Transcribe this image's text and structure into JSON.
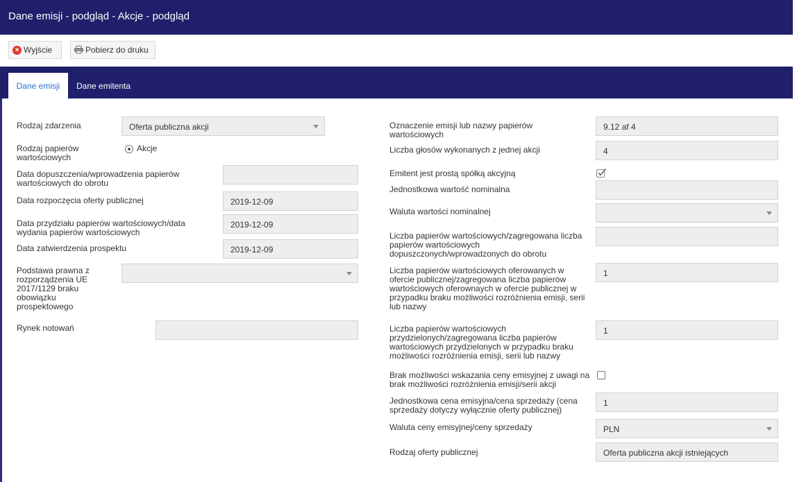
{
  "window": {
    "title": "Dane emisji - podgląd - Akcje - podgląd"
  },
  "toolbar": {
    "exit_label": "Wyjście",
    "print_label": "Pobierz do druku"
  },
  "tabs": [
    {
      "label": "Dane emisji"
    },
    {
      "label": "Dane emitenta"
    }
  ],
  "left": {
    "rodzaj_zdarzenia": {
      "label": "Rodzaj zdarzenia",
      "value": "Oferta publiczna akcji"
    },
    "rodzaj_papierow": {
      "label": "Rodzaj papierów wartościowych",
      "value": "Akcje"
    },
    "data_dopuszczenia": {
      "label": "Data dopuszczenia/wprowadzenia papierów wartościowych do obrotu",
      "value": ""
    },
    "data_rozpoczecia": {
      "label": "Data rozpoczęcia oferty publicznej",
      "value": "2019-12-09"
    },
    "data_przydzialu": {
      "label": "Data przydziału papierów wartościowych/data wydania papierów wartościowych",
      "value": "2019-12-09"
    },
    "data_zatwierdzenia": {
      "label": "Data zatwierdzenia prospektu",
      "value": "2019-12-09"
    },
    "podstawa_prawna": {
      "label": "Podstawa prawna z rozporządzenia UE 2017/1129 braku obowiązku prospektowego",
      "value": ""
    },
    "rynek_notowan": {
      "label": "Rynek notowań",
      "value": ""
    }
  },
  "right": {
    "oznaczenie": {
      "label": "Oznaczenie emisji lub nazwy papierów wartościowych",
      "value": "9.12 af 4"
    },
    "liczba_glosow": {
      "label": "Liczba głosów wykonanych z jednej akcji",
      "value": "4"
    },
    "prosta_spolka": {
      "label": "Emitent jest prostą spółką akcyjną"
    },
    "wartosc_nominalna": {
      "label": "Jednostkowa wartość nominalna",
      "value": ""
    },
    "waluta_nominalnej": {
      "label": "Waluta wartości nominalnej",
      "value": ""
    },
    "liczba_dopuszczonych": {
      "label": "Liczba papierów wartościowych/zagregowana liczba papierów wartościowych dopuszczonych/wprowadzonych do obrotu",
      "value": ""
    },
    "liczba_oferowanych": {
      "label": "Liczba papierów wartościowych oferowanych w ofercie publicznej/zagregowana liczba papierów wartościowych oferownaych w ofercie publicznej w przypadku braku możliwości rozróżnienia emisji, serii lub nazwy",
      "value": "1"
    },
    "liczba_przydzielonych": {
      "label": "Liczba papierów wartościowych przydzielonych/zagregowana liczba papierów wartościowych przydzielonych w przypadku braku możliwości rozróżnienia emisji, serii lub nazwy",
      "value": "1"
    },
    "brak_ceny": {
      "label": "Brak możliwości wskazania ceny emisyjnej z uwagi na brak możliwości rozróżnienia emisji/serii akcji"
    },
    "cena_emisyjna": {
      "label": "Jednostkowa cena emisyjna/cena sprzedaży (cena sprzedaży dotyczy wyłącznie oferty publicznej)",
      "value": "1"
    },
    "waluta_ceny": {
      "label": "Waluta ceny emisyjnej/ceny sprzedaży",
      "value": "PLN"
    },
    "rodzaj_oferty": {
      "label": "Rodzaj oferty publicznej",
      "value": "Oferta publiczna akcji istniejących"
    }
  }
}
